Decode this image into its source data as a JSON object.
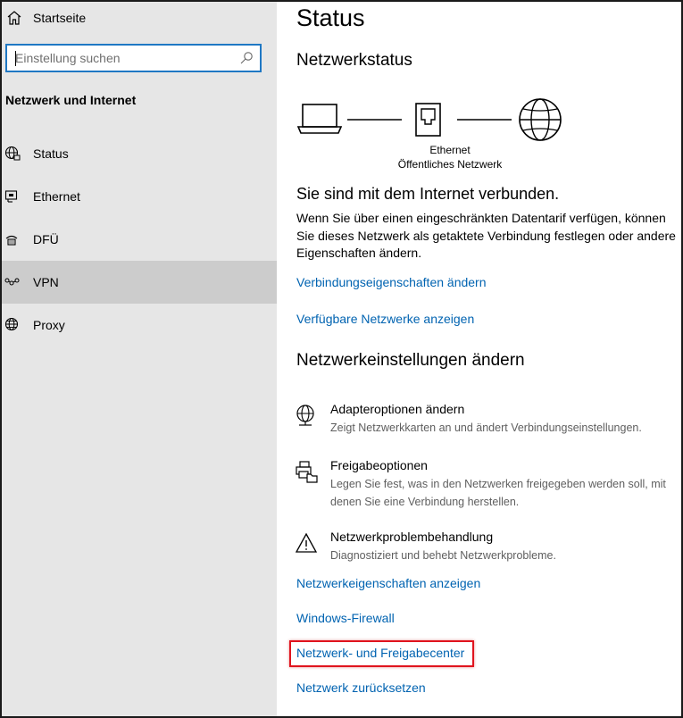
{
  "sidebar": {
    "home_label": "Startseite",
    "search": {
      "placeholder": "Einstellung suchen",
      "value": ""
    },
    "section_title": "Netzwerk und Internet",
    "items": [
      {
        "label": "Status",
        "icon": "globe-status-icon"
      },
      {
        "label": "Ethernet",
        "icon": "ethernet-icon"
      },
      {
        "label": "DFÜ",
        "icon": "dialup-icon"
      },
      {
        "label": "VPN",
        "icon": "vpn-icon",
        "selected": true
      },
      {
        "label": "Proxy",
        "icon": "globe-icon"
      }
    ]
  },
  "main": {
    "title": "Status",
    "network_status_heading": "Netzwerkstatus",
    "diagram": {
      "connection_type": "Ethernet",
      "network_type": "Öffentliches Netzwerk"
    },
    "connected_heading": "Sie sind mit dem Internet verbunden.",
    "connected_text": "Wenn Sie über einen eingeschränkten Datentarif verfügen, können Sie dieses Netzwerk als getaktete Verbindung festlegen oder andere Eigenschaften ändern.",
    "link_connection_props": "Verbindungseigenschaften ändern",
    "link_available_networks": "Verfügbare Netzwerke anzeigen",
    "change_heading": "Netzwerkeinstellungen ändern",
    "settings": [
      {
        "title": "Adapteroptionen ändern",
        "desc": "Zeigt Netzwerkkarten an und ändert Verbindungseinstellungen.",
        "icon": "adapter-globe-icon"
      },
      {
        "title": "Freigabeoptionen",
        "desc": "Legen Sie fest, was in den Netzwerken freigegeben werden soll, mit denen Sie eine Verbindung herstellen.",
        "icon": "sharing-icon"
      },
      {
        "title": "Netzwerkproblembehandlung",
        "desc": "Diagnostiziert und behebt Netzwerkprobleme.",
        "icon": "warning-icon"
      }
    ],
    "links": [
      "Netzwerkeigenschaften anzeigen",
      "Windows-Firewall",
      "Netzwerk- und Freigabecenter",
      "Netzwerk zurücksetzen"
    ]
  },
  "colors": {
    "link": "#0063b1",
    "sidebar_bg": "#e6e6e6",
    "selected_bg": "#cccccc",
    "search_border": "#1f78c4",
    "highlight_border": "#e0141e"
  }
}
